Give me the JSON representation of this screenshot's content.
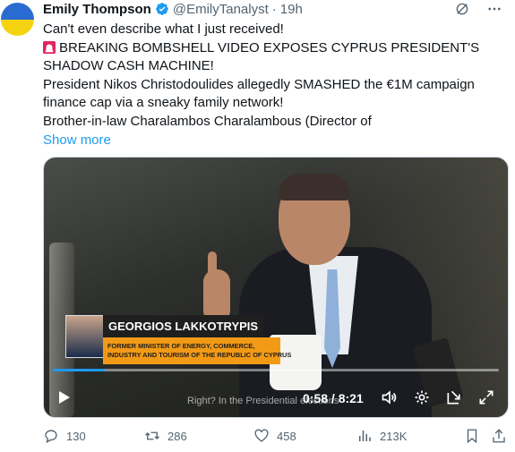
{
  "tweet": {
    "author_name": "Emily Thompson",
    "handle": "@EmilyTanalyst",
    "separator": "·",
    "time": "19h",
    "lines": [
      "Can't even describe what I just received!",
      "BREAKING BOMBSHELL VIDEO EXPOSES CYPRUS PRESIDENT'S",
      "SHADOW CASH MACHINE!",
      "President Nikos Christodoulides allegedly SMASHED the €1M campaign",
      "finance cap via a sneaky family network!",
      "Brother-in-law Charalambos Charalambous (Director of"
    ],
    "show_more": "Show more"
  },
  "video": {
    "caption_name": "GEORGIOS LAKKOTRYPIS",
    "caption_role_lines": [
      "FORMER MINISTER OF ENERGY, COMMERCE,",
      "INDUSTRY AND TOURISM OF THE REPUBLIC OF CYPRUS"
    ],
    "subtitle": "Right? In the Presidential elections",
    "time_readout": "0:58 / 8:21",
    "progress": 0.116
  },
  "actions": {
    "replies": "130",
    "reposts": "286",
    "likes": "458",
    "views": "213K"
  },
  "colors": {
    "accent": "#1d9bf0",
    "muted": "#536471",
    "lower_third_bar": "#f29a16"
  }
}
